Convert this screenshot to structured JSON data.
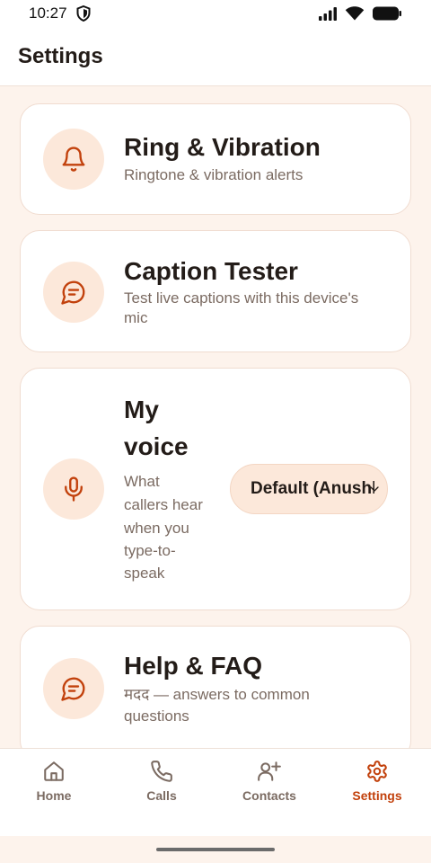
{
  "status_bar": {
    "time": "10:27",
    "icons": [
      "shield-icon",
      "signal-icon",
      "wifi-icon",
      "battery-icon"
    ]
  },
  "header": {
    "title": "Settings"
  },
  "cards": [
    {
      "title": "Ring & Vibration",
      "subtitle": "Ringtone & vibration alerts",
      "icon": "bell-icon"
    },
    {
      "title": "Caption Tester",
      "subtitle_lines": [
        "Test live captions with this device's",
        "mic"
      ],
      "icon": "message-icon"
    },
    {
      "title_lines": [
        "My",
        "voice"
      ],
      "subtitle_lines": [
        "What",
        "callers hear",
        "when you",
        "type-to-",
        "speak"
      ],
      "icon": "mic-icon",
      "select_value": "Default (Anushka)"
    },
    {
      "title": "Help & FAQ",
      "subtitle_lines": [
        "मदद — answers to common",
        "questions"
      ],
      "icon": "message-icon"
    }
  ],
  "nav": {
    "items": [
      {
        "label": "Home",
        "icon": "home-icon"
      },
      {
        "label": "Calls",
        "icon": "phone-icon"
      },
      {
        "label": "Contacts",
        "icon": "add-contact-icon"
      },
      {
        "label": "Settings",
        "icon": "gear-icon",
        "active": true
      }
    ]
  },
  "colors": {
    "accent": "#c2410c",
    "icon_bg": "#fce8da",
    "page_bg": "#fdf3ec",
    "muted_text": "#7b6b62"
  }
}
